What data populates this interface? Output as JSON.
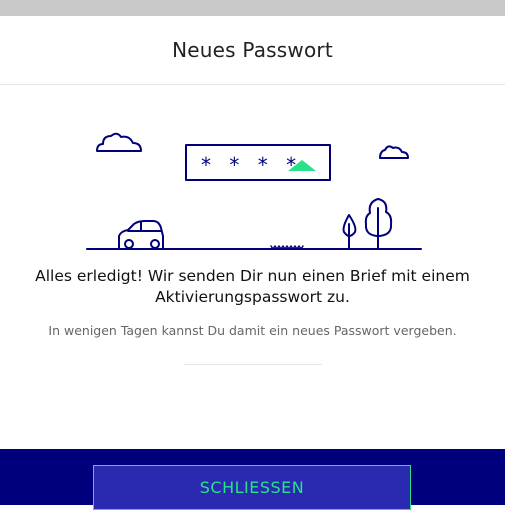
{
  "modal": {
    "title": "Neues Passwort",
    "message": "Alles erledigt! Wir senden Dir nun einen Brief mit einem Aktivierungspasswort zu.",
    "sub_message": "In wenigen Tagen kannst Du damit ein neues Passwort vergeben.",
    "close_label": "SCHLIESSEN"
  },
  "illustration": {
    "password_mask": "* * * *",
    "accent_color": "#27e28a",
    "line_color": "#00007d",
    "icons": [
      "cloud-icon",
      "car-icon",
      "tree-icon",
      "password-field-icon"
    ]
  },
  "colors": {
    "footer_bg": "#00007d",
    "button_bg": "#2a2ab0",
    "button_text": "#27e28a"
  }
}
